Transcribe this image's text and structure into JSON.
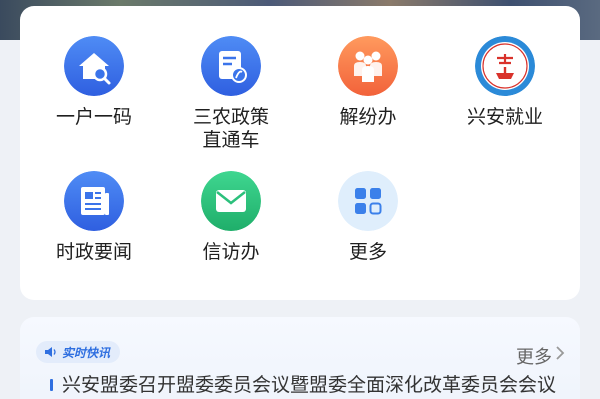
{
  "services": {
    "items": [
      {
        "label": "一户一码",
        "icon": "house-search-icon"
      },
      {
        "label": "三农政策\n直通车",
        "icon": "policy-document-icon"
      },
      {
        "label": "解纷办",
        "icon": "people-group-icon"
      },
      {
        "label": "兴安就业",
        "icon": "employment-emblem-icon"
      },
      {
        "label": "时政要闻",
        "icon": "newspaper-icon"
      },
      {
        "label": "信访办",
        "icon": "envelope-icon"
      },
      {
        "label": "更多",
        "icon": "grid-apps-icon"
      }
    ]
  },
  "news": {
    "badge_label": "实时快讯",
    "more_label": "更多",
    "headline": "兴安盟委召开盟委委员会议暨盟委全面深化改革委员会会议"
  },
  "colors": {
    "blue_icon": "#3b74ea",
    "orange_icon": "#fb7a4a",
    "green_icon": "#2cc07c",
    "light_grid_bg": "#dfeefc",
    "accent": "#2f6fe0"
  }
}
